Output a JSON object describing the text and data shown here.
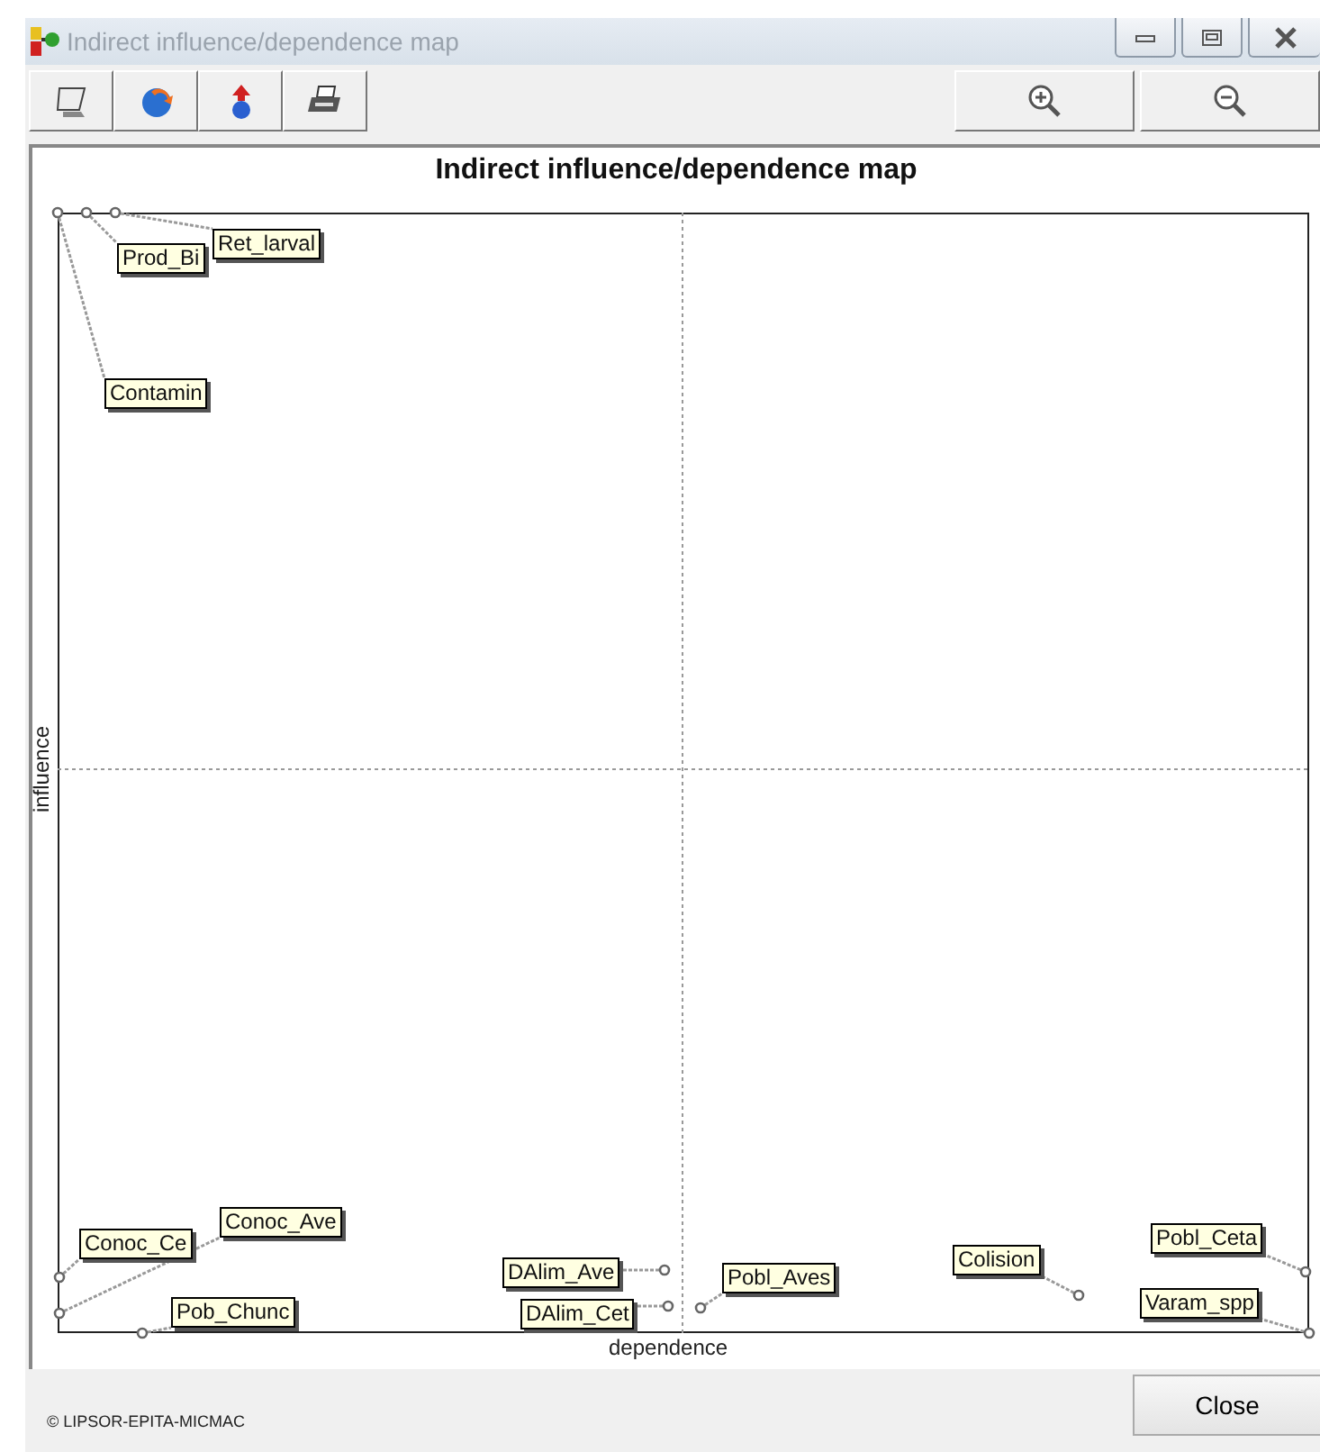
{
  "window": {
    "title": "Indirect influence/dependence map"
  },
  "map": {
    "title": "Indirect influence/dependence map",
    "xlabel": "dependence",
    "ylabel": "influence",
    "points": [
      {
        "label": "Ret_larval"
      },
      {
        "label": "Prod_Bi"
      },
      {
        "label": "Contamin"
      },
      {
        "label": "Conoc_Ave"
      },
      {
        "label": "Pobl_Ceta"
      },
      {
        "label": "Conoc_Ce"
      },
      {
        "label": "Colision"
      },
      {
        "label": "DAlim_Ave"
      },
      {
        "label": "Pobl_Aves"
      },
      {
        "label": "Varam_spp"
      },
      {
        "label": "Pob_Chunc"
      },
      {
        "label": "DAlim_Cet"
      }
    ]
  },
  "footer": {
    "copyright": "© LIPSOR-EPITA-MICMAC",
    "close_button": "Close"
  }
}
